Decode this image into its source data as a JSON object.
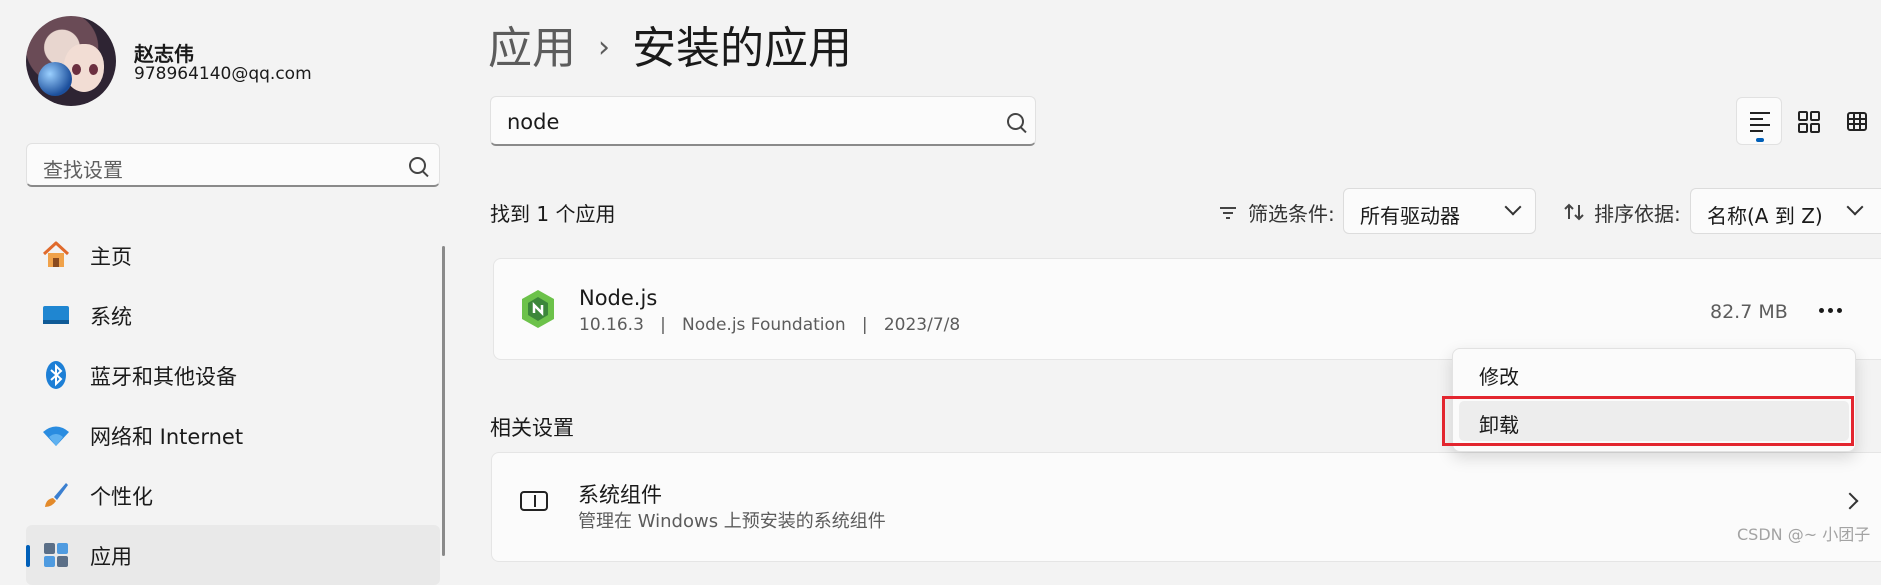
{
  "user": {
    "name": "赵志伟",
    "email": "978964140@qq.com"
  },
  "sidebar": {
    "search_placeholder": "查找设置",
    "items": [
      {
        "label": "主页",
        "icon": "home-icon"
      },
      {
        "label": "系统",
        "icon": "system-icon"
      },
      {
        "label": "蓝牙和其他设备",
        "icon": "bluetooth-icon"
      },
      {
        "label": "网络和 Internet",
        "icon": "wifi-icon"
      },
      {
        "label": "个性化",
        "icon": "brush-icon"
      },
      {
        "label": "应用",
        "icon": "apps-icon",
        "active": true
      }
    ]
  },
  "header": {
    "crumb_parent": "应用",
    "crumb_current": "安装的应用"
  },
  "search": {
    "value": "node"
  },
  "results": {
    "found_text": "找到 1 个应用"
  },
  "filter": {
    "label": "筛选条件:",
    "value": "所有驱动器"
  },
  "sort": {
    "label": "排序依据:",
    "value": "名称(A 到 Z)"
  },
  "app": {
    "name": "Node.js",
    "version": "10.16.3",
    "publisher": "Node.js Foundation",
    "date": "2023/7/8",
    "size": "82.7 MB"
  },
  "context_menu": {
    "items": [
      "修改",
      "卸载"
    ]
  },
  "related": {
    "heading": "相关设置",
    "title": "系统组件",
    "description": "管理在 Windows 上预安装的系统组件"
  },
  "watermark": "CSDN @~ 小团子",
  "colors": {
    "accent": "#005fb8",
    "highlight": "#e3262f",
    "node_green": "#6cc24a"
  }
}
